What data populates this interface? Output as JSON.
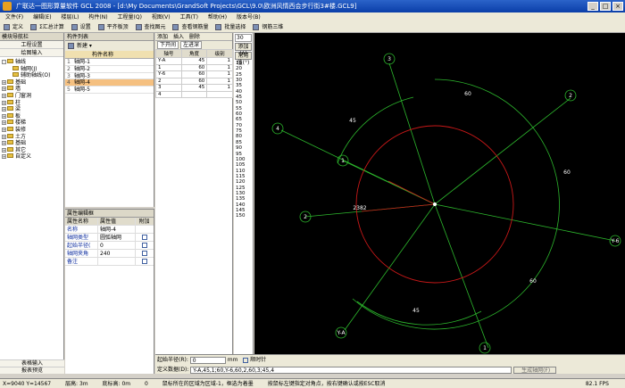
{
  "window": {
    "title": "广联达一图形算量软件 GCL 2008 - [d:\\My Documents\\GrandSoft Projects\\GCL\\9.0\\欧洲风情西会步行街3#楼.GCL9]"
  },
  "menu": [
    "文件(F)",
    "编辑(E)",
    "楼层(L)",
    "构件(N)",
    "工程量(Q)",
    "视图(V)",
    "工具(T)",
    "帮助(H)",
    "版本号(B)"
  ],
  "toolbar1": [
    "定义",
    "Σ汇总计算",
    "设置",
    "平齐板顶",
    "查找图元",
    "查看钢筋量",
    "批量选择",
    "钢筋三维"
  ],
  "toolbar2": [
    "添加",
    "插入",
    "删除",
    "清空",
    "轴网反向",
    "轴号自动生成",
    "设置插入点",
    "读取",
    "存盘",
    "全屏",
    "平移",
    "缩放"
  ],
  "nav": {
    "title": "模块导航栏",
    "tab1": "工程设置",
    "tab2": "绘图输入",
    "tree": [
      "轴线",
      "轴网(J)",
      "辅助轴线(O)",
      "基础",
      "墙",
      "门窗洞",
      "柱",
      "梁",
      "板",
      "楼梯",
      "装修",
      "土方",
      "基础",
      "其它",
      "自定义"
    ],
    "bottom1": "表格输入",
    "bottom2": "报表预览"
  },
  "list": {
    "title": "构件列表",
    "new_label": "新建",
    "header": "构件名称",
    "rows": [
      "轴网-1",
      "轴网-2",
      "轴网-3",
      "轴网-4",
      "轴网-5"
    ],
    "selected_index": 3
  },
  "attr": {
    "title": "属性编辑框",
    "headers": [
      "属性名称",
      "属性值",
      "附加"
    ],
    "rows": [
      {
        "name": "名称",
        "value": "轴网-4"
      },
      {
        "name": "轴网类型",
        "value": "圆弧轴网"
      },
      {
        "name": "起始半径(",
        "value": "0"
      },
      {
        "name": "轴网夹角",
        "value": "240"
      },
      {
        "name": "备注",
        "value": ""
      }
    ]
  },
  "edit": {
    "tab1": "下开间",
    "tab2": "左进深",
    "headers": [
      "轴号",
      "角度",
      "级别"
    ],
    "rows": [
      [
        "Y-A",
        "45",
        "1"
      ],
      [
        "1",
        "60",
        "1"
      ],
      [
        "Y-6",
        "60",
        "1"
      ],
      [
        "2",
        "60",
        "1"
      ],
      [
        "3",
        "45",
        "1"
      ],
      [
        "4",
        "",
        ""
      ]
    ]
  },
  "angles": {
    "input": "30",
    "add_label": "添加(A)",
    "common_label": "常用值(°)",
    "values": [
      "15",
      "20",
      "25",
      "30",
      "35",
      "40",
      "45",
      "50",
      "55",
      "60",
      "65",
      "70",
      "75",
      "80",
      "85",
      "90",
      "95",
      "100",
      "105",
      "110",
      "115",
      "120",
      "125",
      "130",
      "135",
      "140",
      "145",
      "150"
    ]
  },
  "cmd": {
    "radius_label": "起始半径(R):",
    "radius_value": "0",
    "radius_unit": "mm",
    "clockwise_label": "顺时针",
    "define_label": "定义数据(D):",
    "define_value": "Y-A,45,1;60,Y-6,60,2,60,3;45,4",
    "gen_label": "生成轴网(F)"
  },
  "canvas": {
    "labels": [
      "3",
      "2",
      "4",
      "1",
      "2",
      "Y-6",
      "Y-A",
      "1"
    ],
    "dims": [
      "60",
      "45",
      "60",
      "2382",
      "60",
      "45"
    ]
  },
  "status": {
    "coords": "X=9040 Y=14567",
    "floor": "层高: 3m",
    "base": "底标高: 0m",
    "zero": "0",
    "hint": "鼠标所在的区域为区域-1，框选为着墨",
    "hint2": "按鼠标左键指定对角点，按右键确认或按ESC取消",
    "fps": "82.1 FPS"
  },
  "colors": {
    "accent": "#0a3ea8",
    "canvas_bg": "#000000",
    "axis_green": "#2db82d",
    "arc_red": "#c81818"
  }
}
